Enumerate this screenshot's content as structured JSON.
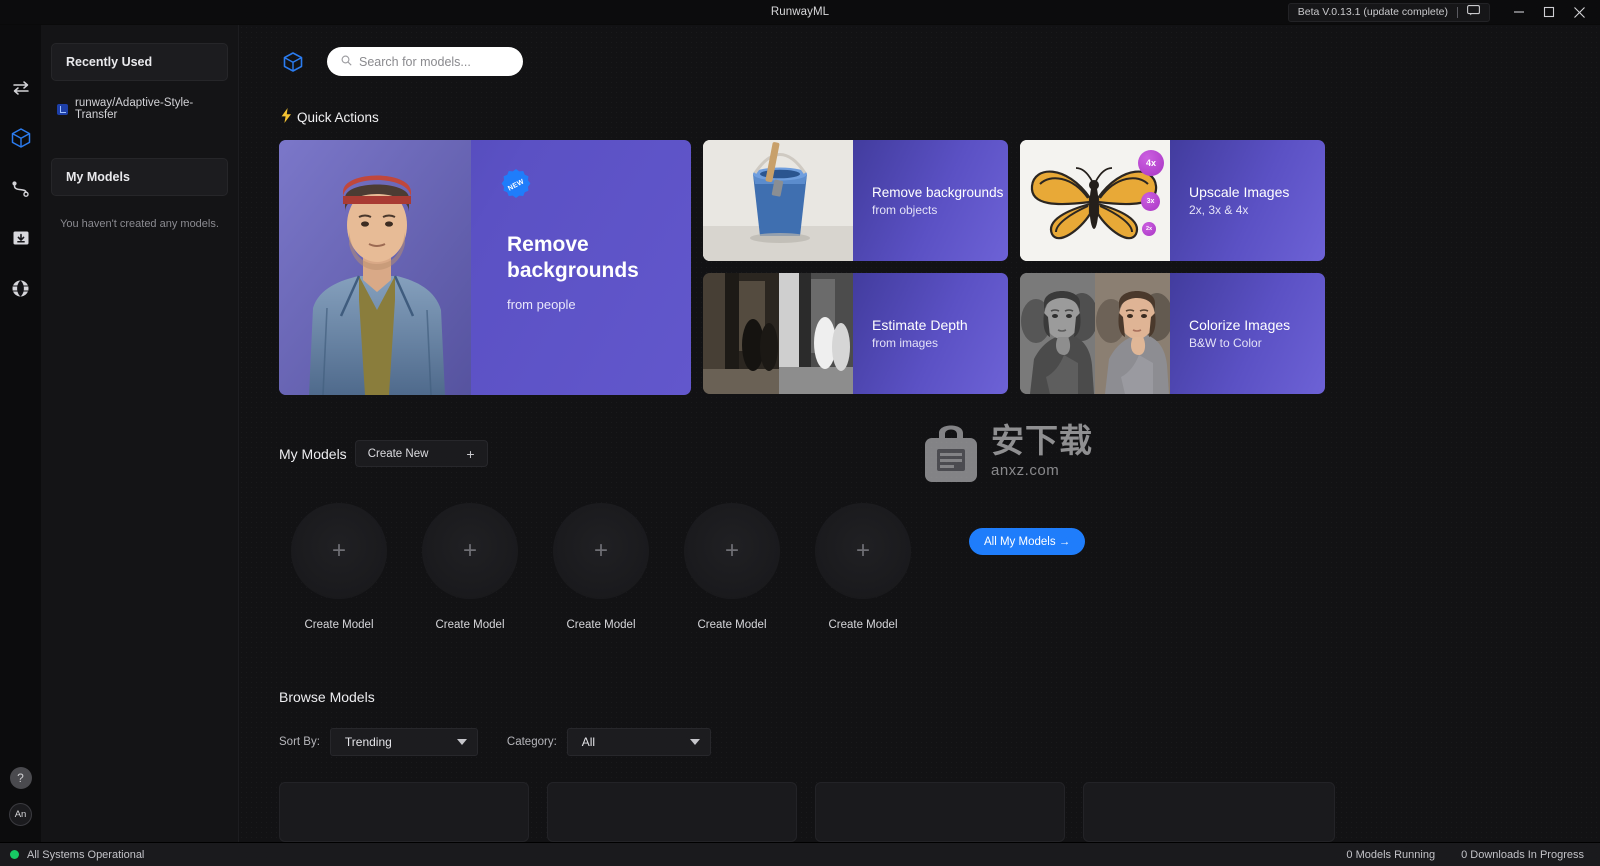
{
  "titlebar": {
    "title": "RunwayML",
    "version_label": "Beta V.0.13.1 (update complete)",
    "feedback_icon": "chat-bubble-icon",
    "minimize_icon": "minimize-icon",
    "maximize_icon": "maximize-icon",
    "close_icon": "close-icon"
  },
  "rail": {
    "items": [
      {
        "icon": "transfer-arrows-icon",
        "name": "transfer"
      },
      {
        "icon": "cube-icon",
        "name": "models",
        "active": true
      },
      {
        "icon": "workflow-node-icon",
        "name": "workflows"
      },
      {
        "icon": "download-box-icon",
        "name": "downloads"
      },
      {
        "icon": "globe-icon",
        "name": "network"
      }
    ],
    "help_label": "?",
    "avatar_label": "An"
  },
  "sidebar": {
    "recently_used_label": "Recently Used",
    "recent_items": [
      {
        "icon": "model-file-icon",
        "label": "runway/Adaptive-Style-Transfer"
      }
    ],
    "my_models_label": "My Models",
    "empty_message": "You haven't created any models."
  },
  "search": {
    "placeholder": "Search for models...",
    "icon": "search-icon",
    "brand_icon": "cube-icon"
  },
  "quick_actions": {
    "heading": "Quick Actions",
    "heading_icon": "lightning-bolt-icon",
    "hero": {
      "badge": "NEW",
      "title": "Remove backgrounds",
      "subtitle": "from people",
      "thumbnail": "photo-man-denim-jacket"
    },
    "cards": [
      {
        "title": "Remove backgrounds",
        "subtitle": "from objects",
        "thumbnail": "photo-blue-bucket"
      },
      {
        "title": "Upscale Images",
        "subtitle": "2x, 3x & 4x",
        "thumbnail": "photo-butterfly",
        "badges": [
          "4x",
          "3x",
          "2x"
        ]
      },
      {
        "title": "Estimate Depth",
        "subtitle": "from images",
        "thumbnail": "photo-depth-map"
      },
      {
        "title": "Colorize Images",
        "subtitle": "B&W to Color",
        "thumbnail": "photo-migrant-mother"
      }
    ]
  },
  "my_models": {
    "title": "My Models",
    "create_new_label": "Create New",
    "create_new_plus": "+",
    "slots": [
      {
        "caption": "Create Model",
        "plus": "+"
      },
      {
        "caption": "Create Model",
        "plus": "+"
      },
      {
        "caption": "Create Model",
        "plus": "+"
      },
      {
        "caption": "Create Model",
        "plus": "+"
      },
      {
        "caption": "Create Model",
        "plus": "+"
      }
    ],
    "all_models_label": "All My Models →"
  },
  "browse": {
    "title": "Browse Models",
    "sort_label": "Sort By:",
    "sort_value": "Trending",
    "category_label": "Category:",
    "category_value": "All"
  },
  "watermark": {
    "text_cn": "安下载",
    "url": "anxz.com",
    "icon": "shopping-bag-icon"
  },
  "statusbar": {
    "status_text": "All Systems Operational",
    "status_color": "#17c964",
    "models_running": "0 Models Running",
    "downloads_in_progress": "0 Downloads In Progress"
  },
  "colors": {
    "accent_blue": "#1f7dfb",
    "card_purple": "#5b51c4",
    "badge_magenta": "#a936c4",
    "status_green": "#17c964"
  }
}
